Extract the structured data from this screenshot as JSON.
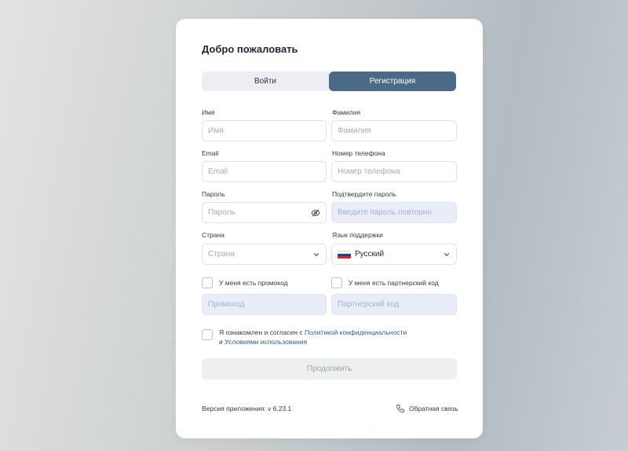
{
  "card": {
    "title": "Добро пожаловать",
    "tabs": [
      {
        "label": "Войти",
        "active": false
      },
      {
        "label": "Регистрация",
        "active": true
      }
    ]
  },
  "form": {
    "first_name": {
      "label": "Имя",
      "placeholder": "Имя",
      "value": ""
    },
    "last_name": {
      "label": "Фамилия",
      "placeholder": "Фамилия",
      "value": ""
    },
    "email": {
      "label": "Email",
      "placeholder": "Email",
      "value": ""
    },
    "phone": {
      "label": "Номер телефона",
      "placeholder": "Номер телефона",
      "value": ""
    },
    "password": {
      "label": "Пароль",
      "placeholder": "Пароль",
      "value": "",
      "icon": "eye-off-icon"
    },
    "password_confirm": {
      "label": "Подтвердите пароль",
      "placeholder": "Введите пароль повторно",
      "value": ""
    },
    "country": {
      "label": "Страна",
      "placeholder": "Страна",
      "icon": "chevron-down-icon"
    },
    "language": {
      "label": "Язык поддержки",
      "value": "Русский",
      "icon": "chevron-down-icon",
      "flag_colors": [
        "#ffffff",
        "#1c3f94",
        "#e4212b"
      ]
    },
    "promo": {
      "check_label": "У меня есть промокод",
      "checked": false,
      "placeholder": "Промокод"
    },
    "partner": {
      "check_label": "У меня есть партнерский код",
      "checked": false,
      "placeholder": "Партнерский код"
    },
    "agree": {
      "checked": false,
      "text_before": "Я ознакомлен и согласен с",
      "privacy_link": "Политикой конфиденциальности",
      "text_mid": "и",
      "terms_link": "Условиями использования"
    },
    "continue_label": "Продолжить"
  },
  "footer": {
    "version": "Версия приложения: v 6.23.1",
    "feedback_label": "Обратная связь",
    "feedback_icon": "phone-icon"
  },
  "colors": {
    "accent": "#4b6a86",
    "link": "#2e5b88",
    "disabled_field": "#e8edf9"
  }
}
